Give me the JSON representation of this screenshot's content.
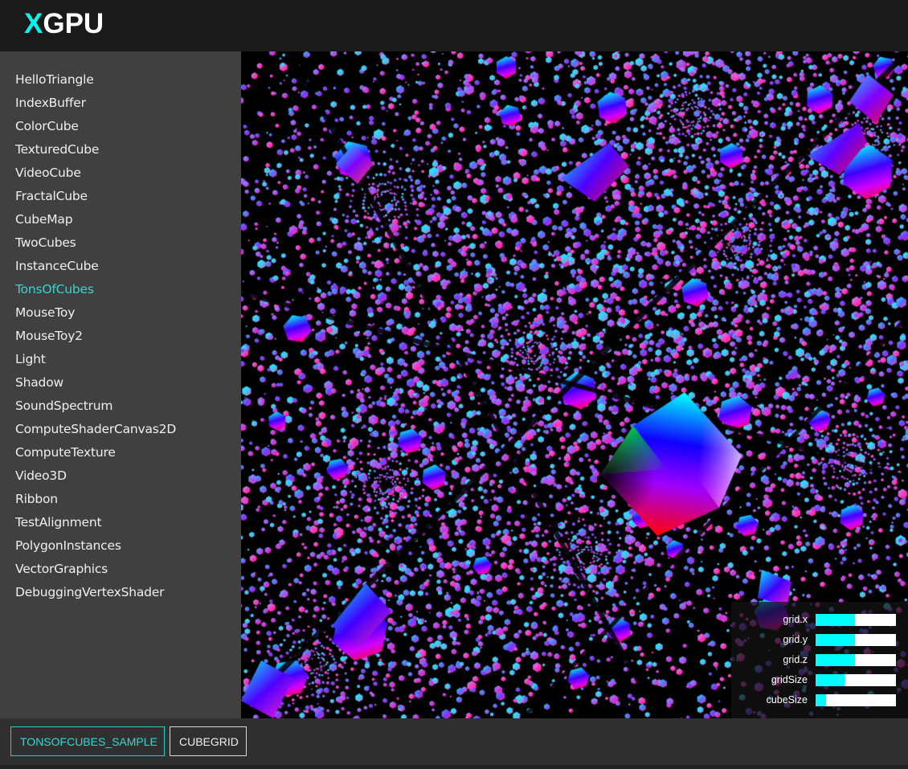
{
  "header": {
    "logo_accent": "X",
    "logo_rest": "GPU"
  },
  "sidebar": {
    "active_index": 9,
    "items": [
      {
        "label": "HelloTriangle"
      },
      {
        "label": "IndexBuffer"
      },
      {
        "label": "ColorCube"
      },
      {
        "label": "TexturedCube"
      },
      {
        "label": "VideoCube"
      },
      {
        "label": "FractalCube"
      },
      {
        "label": "CubeMap"
      },
      {
        "label": "TwoCubes"
      },
      {
        "label": "InstanceCube"
      },
      {
        "label": "TonsOfCubes"
      },
      {
        "label": "MouseToy"
      },
      {
        "label": "MouseToy2"
      },
      {
        "label": "Light"
      },
      {
        "label": "Shadow"
      },
      {
        "label": "SoundSpectrum"
      },
      {
        "label": "ComputeShaderCanvas2D"
      },
      {
        "label": "ComputeTexture"
      },
      {
        "label": "Video3D"
      },
      {
        "label": "Ribbon"
      },
      {
        "label": "TestAlignment"
      },
      {
        "label": "PolygonInstances"
      },
      {
        "label": "VectorGraphics"
      },
      {
        "label": "DebuggingVertexShader"
      }
    ]
  },
  "controls": [
    {
      "label": "grid.x",
      "value_fraction": 0.49
    },
    {
      "label": "grid.y",
      "value_fraction": 0.49
    },
    {
      "label": "grid.z",
      "value_fraction": 0.49
    },
    {
      "label": "gridSize",
      "value_fraction": 0.36
    },
    {
      "label": "cubeSize",
      "value_fraction": 0.13
    }
  ],
  "footer": {
    "tabs": [
      {
        "label": "TONSOFCUBES_SAMPLE",
        "active": true
      },
      {
        "label": "CUBEGRID",
        "active": false
      }
    ]
  },
  "colors": {
    "accent": "#00f5f0",
    "active_text": "#38d6d2",
    "slider_fill": "#00ffff",
    "slider_track": "#ffffff",
    "header_bg": "#1a1a1a",
    "sidebar_bg": "#404040",
    "canvas_bg": "#000000"
  }
}
